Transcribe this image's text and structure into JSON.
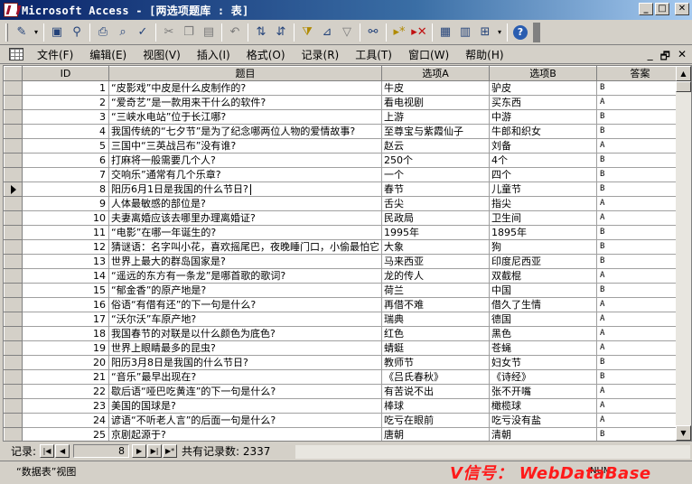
{
  "window": {
    "title": "Microsoft Access - [两选项题库 : 表]"
  },
  "menu": {
    "items": [
      "文件(F)",
      "编辑(E)",
      "视图(V)",
      "插入(I)",
      "格式(O)",
      "记录(R)",
      "工具(T)",
      "窗口(W)",
      "帮助(H)"
    ]
  },
  "toolbar": {
    "icons": [
      "view-icon",
      "save-icon",
      "print-preview-icon",
      "print-icon",
      "spellcheck-icon",
      "cut-icon",
      "copy-icon",
      "paste-icon",
      "undo-icon",
      "sort-ascending-icon",
      "sort-descending-icon",
      "filter-by-selection-icon",
      "filter-by-form-icon",
      "apply-filter-icon",
      "find-icon",
      "new-record-icon",
      "delete-record-icon",
      "properties-icon",
      "database-window-icon",
      "new-object-icon",
      "help-icon"
    ]
  },
  "table": {
    "columns": [
      "ID",
      "题目",
      "选项A",
      "选项B",
      "答案"
    ],
    "current_row": 7,
    "rows": [
      [
        "1",
        "“皮影戏”中皮是什么皮制作的?",
        "牛皮",
        "驴皮",
        "B"
      ],
      [
        "2",
        "“爱奇艺”是一款用来干什么的软件?",
        "看电视剧",
        "买东西",
        "A"
      ],
      [
        "3",
        "“三峡水电站”位于长江哪?",
        "上游",
        "中游",
        "B"
      ],
      [
        "4",
        "我国传统的“七夕节”是为了纪念哪两位人物的爱情故事?",
        "至尊宝与紫霞仙子",
        "牛郎和织女",
        "B"
      ],
      [
        "5",
        "三国中“三英战吕布”没有谁?",
        "赵云",
        "刘备",
        "A"
      ],
      [
        "6",
        "打麻将一般需要几个人?",
        "250个",
        "4个",
        "B"
      ],
      [
        "7",
        "交响乐”通常有几个乐章?",
        "一个",
        "四个",
        "B"
      ],
      [
        "8",
        "阳历6月1日是我国的什么节日?",
        "春节",
        "儿童节",
        "B"
      ],
      [
        "9",
        "人体最敏感的部位是?",
        "舌尖",
        "指尖",
        "A"
      ],
      [
        "10",
        "夫妻离婚应该去哪里办理离婚证?",
        "民政局",
        "卫生间",
        "A"
      ],
      [
        "11",
        "“电影”在哪一年诞生的?",
        "1995年",
        "1895年",
        "B"
      ],
      [
        "12",
        "猜谜语：名字叫小花，喜欢摇尾巴，夜晚睡门口，小偷最怕它",
        "大象",
        "狗",
        "B"
      ],
      [
        "13",
        "世界上最大的群岛国家是?",
        "马来西亚",
        "印度尼西亚",
        "B"
      ],
      [
        "14",
        "“遥远的东方有一条龙”是哪首歌的歌词?",
        "龙的传人",
        "双截棍",
        "A"
      ],
      [
        "15",
        "“郁金香”的原产地是?",
        "荷兰",
        "中国",
        "B"
      ],
      [
        "16",
        "俗语“有借有还”的下一句是什么?",
        "再借不难",
        "借久了生情",
        "A"
      ],
      [
        "17",
        "“沃尔沃”车原产地?",
        "瑞典",
        "德国",
        "A"
      ],
      [
        "18",
        "我国春节的对联是以什么颜色为底色?",
        "红色",
        "黑色",
        "A"
      ],
      [
        "19",
        "世界上眼睛最多的昆虫?",
        "蜻蜓",
        "苍蝇",
        "A"
      ],
      [
        "20",
        "阳历3月8日是我国的什么节日?",
        "教师节",
        "妇女节",
        "B"
      ],
      [
        "21",
        "“音乐”最早出现在?",
        "《吕氏春秋》",
        "《诗经》",
        "B"
      ],
      [
        "22",
        "歇后语“哑巴吃黄连”的下一句是什么?",
        "有苦说不出",
        "张不开嘴",
        "A"
      ],
      [
        "23",
        "美国的国球是?",
        "棒球",
        "橄榄球",
        "A"
      ],
      [
        "24",
        "谚语“不听老人言”的后面一句是什么?",
        "吃亏在眼前",
        "吃亏没有盐",
        "A"
      ],
      [
        "25",
        "京剧起源于?",
        "唐朝",
        "清朝",
        "B"
      ]
    ]
  },
  "record_nav": {
    "label": "记录:",
    "current": "8",
    "total_label": "共有记录数: 2337"
  },
  "status": {
    "text": "“数据表”视图",
    "mode": "NUM"
  },
  "watermark": {
    "text": "V信号： WebDataBase"
  }
}
